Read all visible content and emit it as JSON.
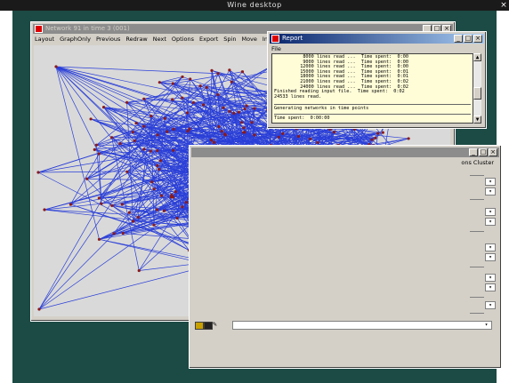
{
  "desktop": {
    "title": "Wine desktop",
    "close": "×",
    "bg_color": "#1c4a44"
  },
  "network_window": {
    "title": "Network 91 in time 3 (001)",
    "menu": [
      "Layout",
      "GraphOnly",
      "Previous",
      "Redraw",
      "Next",
      "Options",
      "Export",
      "Spin",
      "Move",
      "Info"
    ],
    "node_color": "#8b1a1a",
    "edge_color": "#2a3fd8"
  },
  "report_window": {
    "title": "Report",
    "menu": [
      "File"
    ],
    "lines_read": [
      "8000 lines read ...  Time spent:  0:00",
      "9000 lines read ...  Time spent:  0:00",
      "12000 lines read ...  Time spent:  0:00",
      "15000 lines read ...  Time spent:  0:01",
      "18000 lines read ...  Time spent:  0:01",
      "21000 lines read ...  Time spent:  0:02",
      "24000 lines read ...  Time spent:  0:02"
    ],
    "finished": "Finished reading input file.  Time spent:  0:02",
    "total": "24533 lines read.",
    "generating": "Generating networks in time points",
    "time_spent": "Time spent:  0:00:00"
  },
  "bg_window": {
    "menu_fragment": "ons  Cluster",
    "icons": [
      "open-icon",
      "save-icon",
      "edit-icon"
    ]
  }
}
